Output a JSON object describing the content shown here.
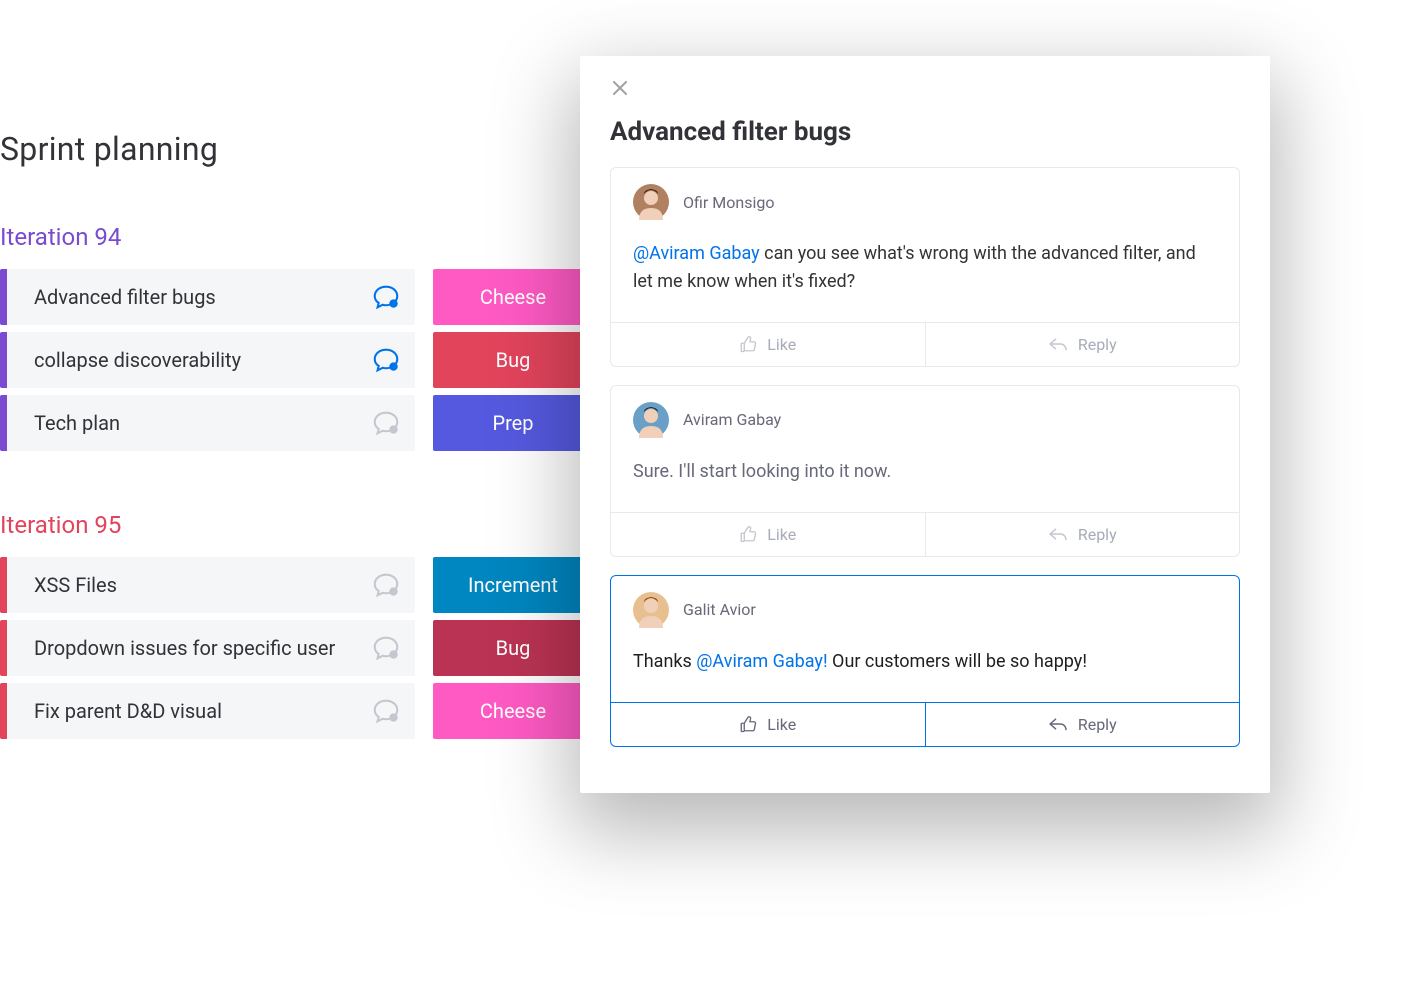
{
  "board": {
    "title": "Sprint planning",
    "groups": [
      {
        "id": "iteration-94",
        "title": "Iteration 94",
        "color": "purple",
        "rows": [
          {
            "label": "Advanced filter bugs",
            "tag": "Cheese",
            "tagClass": "tag-cheese",
            "chat_active": true
          },
          {
            "label": "collapse discoverability",
            "tag": "Bug",
            "tagClass": "tag-bug",
            "chat_active": true
          },
          {
            "label": "Tech plan",
            "tag": "Prep",
            "tagClass": "tag-prep",
            "chat_active": false
          }
        ]
      },
      {
        "id": "iteration-95",
        "title": "Iteration 95",
        "color": "red",
        "rows": [
          {
            "label": "XSS Files",
            "tag": "Increment",
            "tagClass": "tag-increment",
            "chat_active": false
          },
          {
            "label": "Dropdown issues for specific user",
            "tag": "Bug",
            "tagClass": "tag-bug2",
            "chat_active": false
          },
          {
            "label": "Fix parent D&D visual",
            "tag": "Cheese",
            "tagClass": "tag-cheese",
            "chat_active": false
          }
        ]
      }
    ]
  },
  "panel": {
    "title": "Advanced filter bugs",
    "like_label": "Like",
    "reply_label": "Reply",
    "comments": [
      {
        "author": "Ofir Monsigo",
        "avatar": "ofir",
        "segments": [
          {
            "text": "@Aviram Gabay",
            "mention": true
          },
          {
            "text": " can you see what's wrong with the advanced filter, and let me know when it's fixed?",
            "mention": false
          }
        ],
        "body_style": "normal",
        "active": false
      },
      {
        "author": "Aviram Gabay",
        "avatar": "aviram",
        "segments": [
          {
            "text": "Sure. I'll start looking into it now.",
            "mention": false
          }
        ],
        "body_style": "muted",
        "active": false
      },
      {
        "author": "Galit Avior",
        "avatar": "galit",
        "segments": [
          {
            "text": "Thanks ",
            "mention": false
          },
          {
            "text": "@Aviram Gabay!",
            "mention": true
          },
          {
            "text": " Our customers will be so happy!",
            "mention": false
          }
        ],
        "body_style": "strong",
        "active": true
      }
    ]
  },
  "colors": {
    "purple": "#784BD1",
    "red": "#E2445C",
    "link": "#0073ea"
  }
}
